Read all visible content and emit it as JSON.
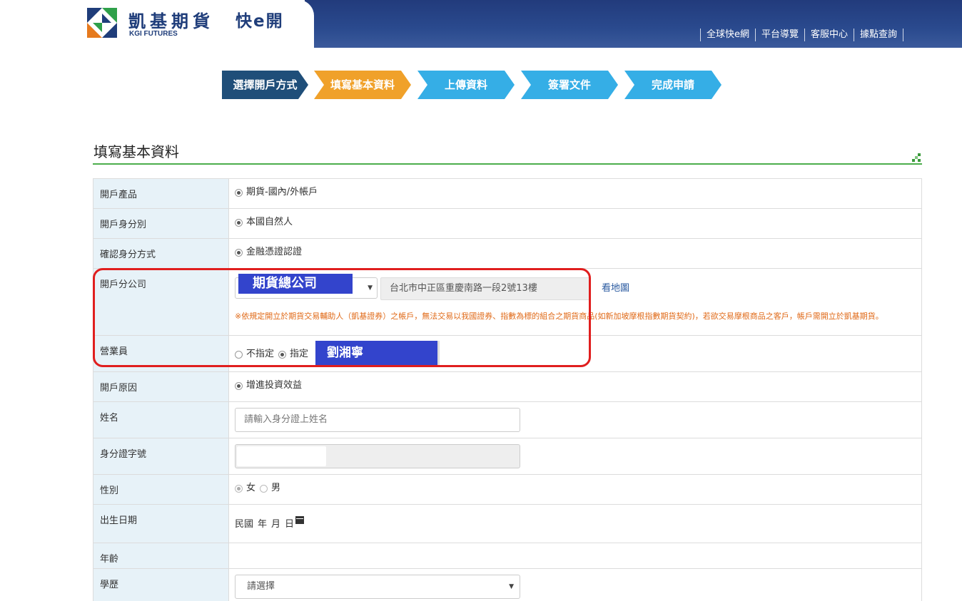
{
  "header": {
    "brand": "凱基期貨",
    "brand_en": "KGI FUTURES",
    "quick_open": "快e開",
    "nav": [
      "全球快e網",
      "平台導覽",
      "客服中心",
      "據點查詢"
    ]
  },
  "steps": [
    {
      "label": "選擇開戶方式",
      "color": "#1f4e79"
    },
    {
      "label": "填寫基本資料",
      "color": "#f0a12a"
    },
    {
      "label": "上傳資料",
      "color": "#35aee6"
    },
    {
      "label": "簽署文件",
      "color": "#35aee6"
    },
    {
      "label": "完成申請",
      "color": "#35aee6"
    }
  ],
  "section_title": "填寫基本資料",
  "form": {
    "product": {
      "label": "開戶產品",
      "option": "期貨-國內/外帳戶"
    },
    "identity": {
      "label": "開戶身分別",
      "option": "本國自然人"
    },
    "verify": {
      "label": "確認身分方式",
      "option": "金融憑證認證"
    },
    "branch": {
      "label": "開戶分公司",
      "selected": "期貨總公司",
      "address": "台北市中正區重慶南路一段2號13樓",
      "map_link": "看地圖",
      "note": "※依規定開立於期貨交易輔助人（凱基證券）之帳戶，無法交易以我國證券、指數為標的組合之期貨商品(如新加坡摩根指數期貨契約)，若欲交易摩根商品之客戶，帳戶需開立於凱基期貨。"
    },
    "agent": {
      "label": "營業員",
      "opt_none": "不指定",
      "opt_assign": "指定",
      "name": "劉湘寧"
    },
    "reason": {
      "label": "開戶原因",
      "option": "增進投資效益"
    },
    "name": {
      "label": "姓名",
      "placeholder": "請輸入身分證上姓名"
    },
    "id_no": {
      "label": "身分證字號"
    },
    "gender": {
      "label": "性別",
      "female": "女",
      "male": "男"
    },
    "birth": {
      "label": "出生日期",
      "roc": "民國",
      "year": "年",
      "month": "月",
      "day": "日"
    },
    "age": {
      "label": "年齡"
    },
    "education": {
      "label": "學歷",
      "selected": "請選擇"
    }
  }
}
